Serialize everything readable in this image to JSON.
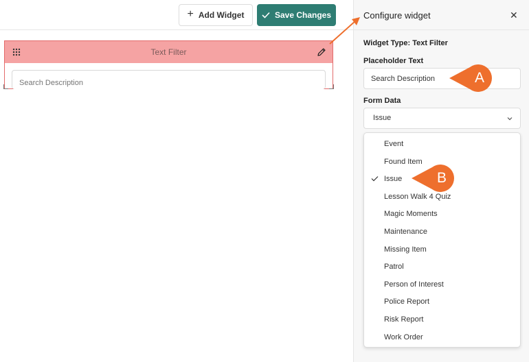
{
  "toolbar": {
    "add_widget_label": "Add Widget",
    "save_changes_label": "Save Changes",
    "add_icon": "plus-icon",
    "save_icon": "check-icon"
  },
  "widget": {
    "title": "Text Filter",
    "input_placeholder": "Search Description",
    "drag_icon": "drag-handle-icon",
    "edit_icon": "pencil-icon"
  },
  "panel": {
    "title": "Configure widget",
    "close_icon": "close-icon",
    "widget_type_label": "Widget Type:",
    "widget_type_value": "Text Filter",
    "placeholder_label": "Placeholder Text",
    "placeholder_value": "Search Description",
    "form_data_label": "Form Data",
    "form_data_selected": "Issue",
    "options": [
      "Event",
      "Found Item",
      "Issue",
      "Lesson Walk 4 Quiz",
      "Magic Moments",
      "Maintenance",
      "Missing Item",
      "Patrol",
      "Person of Interest",
      "Police Report",
      "Risk Report",
      "Work Order"
    ],
    "selected_option_index": 2
  },
  "callouts": {
    "a": "A",
    "b": "B"
  },
  "colors": {
    "primary": "#2e7d73",
    "widget_header": "#f5a3a3",
    "widget_border": "#e36a6a",
    "callout": "#ee6f2d"
  }
}
